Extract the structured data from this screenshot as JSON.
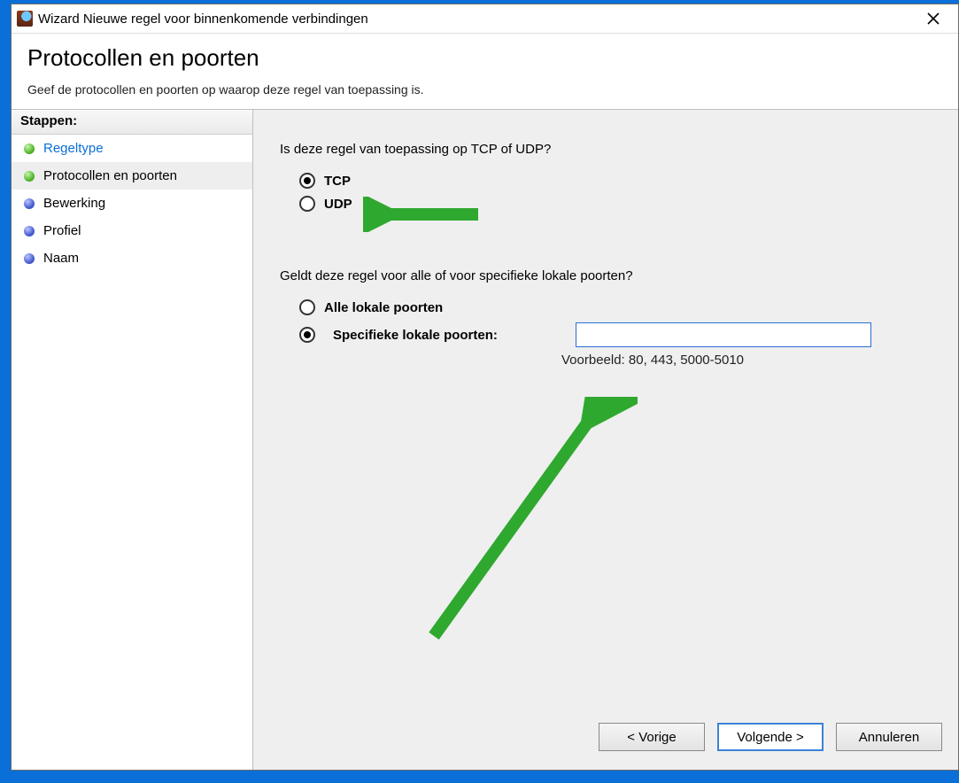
{
  "window": {
    "title": "Wizard Nieuwe regel voor binnenkomende verbindingen"
  },
  "header": {
    "title": "Protocollen en poorten",
    "subtitle": "Geef de protocollen en poorten op waarop deze regel van toepassing is."
  },
  "sidebar": {
    "header": "Stappen:",
    "steps": {
      "ruletype": "Regeltype",
      "protocols": "Protocollen en poorten",
      "action": "Bewerking",
      "profile": "Profiel",
      "name": "Naam"
    }
  },
  "content": {
    "q1": "Is deze regel van toepassing op TCP of UDP?",
    "tcp": "TCP",
    "udp": "UDP",
    "q2": "Geldt deze regel voor alle of voor specifieke lokale poorten?",
    "all_ports": "Alle lokale poorten",
    "specific_ports": "Specifieke lokale poorten:",
    "ports_value": "",
    "example": "Voorbeeld: 80, 443, 5000-5010"
  },
  "footer": {
    "back": "< Vorige",
    "next": "Volgende >",
    "cancel": "Annuleren"
  }
}
